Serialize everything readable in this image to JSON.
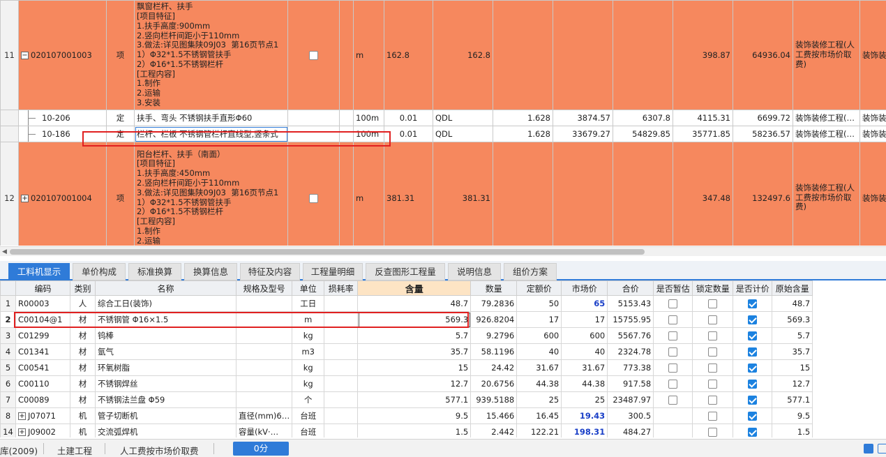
{
  "bills": [
    {
      "num": "11",
      "code": "020107001003",
      "unit_type": "项",
      "desc": "飘窗栏杆、扶手\n[项目特征]\n1.扶手高度:900mm\n2.竖向栏杆间距小于110mm\n3.做法:详见图集陕09J03  第16页节点1\n1）Φ32*1.5不锈钢管扶手\n2）Φ16*1.5不锈钢栏杆\n[工程内容]\n1.制作\n2.运输\n3.安装",
      "unit": "m",
      "qty_expr": "162.8",
      "qty": "162.8",
      "price": "398.87",
      "total": "64936.04",
      "category": "装饰装修工程(人工费按市场价取费)",
      "profession": "装饰装修"
    },
    {
      "num": "12",
      "code": "020107001004",
      "unit_type": "项",
      "desc": "阳台栏杆、扶手（南面）\n[项目特征]\n1.扶手高度:450mm\n2.竖向栏杆间距小于110mm\n3.做法:详见图集陕09J03  第16页节点1\n1）Φ32*1.5不锈钢管扶手\n2）Φ16*1.5不锈钢栏杆\n[工程内容]\n1.制作\n2.运输",
      "unit": "m",
      "qty_expr": "381.31",
      "qty": "381.31",
      "price": "347.48",
      "total": "132497.6",
      "category": "装饰装修工程(人工费按市场价取费)",
      "profession": "装饰装修"
    }
  ],
  "quotas": [
    {
      "code": "10-206",
      "type": "定",
      "name": "扶手、弯头 不锈钢扶手直形Φ60",
      "unit": "100m",
      "ratio": "0.01",
      "expr": "QDL",
      "qty": "1.628",
      "unit_price": "3874.57",
      "base": "6307.8",
      "price2": "4115.31",
      "total": "6699.72",
      "category": "装饰装修工程(…",
      "profession": "装饰装修"
    },
    {
      "code": "10-186",
      "type": "定",
      "name": "栏杆、栏板 不锈钢管栏杆直线型,竖条式",
      "unit": "100m",
      "ratio": "0.01",
      "expr": "QDL",
      "qty": "1.628",
      "unit_price": "33679.27",
      "base": "54829.85",
      "price2": "35771.85",
      "total": "58236.57",
      "category": "装饰装修工程(…",
      "profession": "装饰装修"
    }
  ],
  "tabs": [
    "工料机显示",
    "单价构成",
    "标准换算",
    "换算信息",
    "特征及内容",
    "工程量明细",
    "反查图形工程量",
    "说明信息",
    "组价方案"
  ],
  "res_headers": [
    "",
    "编码",
    "类别",
    "名称",
    "规格及型号",
    "单位",
    "损耗率",
    "含量",
    "数量",
    "定额价",
    "市场价",
    "合价",
    "是否暂估",
    "锁定数量",
    "是否计价",
    "原始含量"
  ],
  "resources": [
    {
      "idx": "1",
      "code": "R00003",
      "type": "人",
      "name": "综合工日(装饰)",
      "spec": "",
      "unit": "工日",
      "content": "48.7",
      "qty": "79.2836",
      "base": "50",
      "market": "65",
      "total": "5153.43",
      "est": false,
      "lock": false,
      "priced": true,
      "orig": "48.7"
    },
    {
      "idx": "2",
      "code": "C00104@1",
      "type": "材",
      "name": "不锈钢管 Φ16×1.5",
      "spec": "",
      "unit": "m",
      "content": "569.3",
      "qty": "926.8204",
      "base": "17",
      "market": "17",
      "total": "15755.95",
      "est": false,
      "lock": false,
      "priced": true,
      "orig": "569.3"
    },
    {
      "idx": "3",
      "code": "C01299",
      "type": "材",
      "name": "钨棒",
      "spec": "",
      "unit": "kg",
      "content": "5.7",
      "qty": "9.2796",
      "base": "600",
      "market": "600",
      "total": "5567.76",
      "est": false,
      "lock": false,
      "priced": true,
      "orig": "5.7"
    },
    {
      "idx": "4",
      "code": "C01341",
      "type": "材",
      "name": "氩气",
      "spec": "",
      "unit": "m3",
      "content": "35.7",
      "qty": "58.1196",
      "base": "40",
      "market": "40",
      "total": "2324.78",
      "est": false,
      "lock": false,
      "priced": true,
      "orig": "35.7"
    },
    {
      "idx": "5",
      "code": "C00541",
      "type": "材",
      "name": "环氧树脂",
      "spec": "",
      "unit": "kg",
      "content": "15",
      "qty": "24.42",
      "base": "31.67",
      "market": "31.67",
      "total": "773.38",
      "est": false,
      "lock": false,
      "priced": true,
      "orig": "15"
    },
    {
      "idx": "6",
      "code": "C00110",
      "type": "材",
      "name": "不锈钢焊丝",
      "spec": "",
      "unit": "kg",
      "content": "12.7",
      "qty": "20.6756",
      "base": "44.38",
      "market": "44.38",
      "total": "917.58",
      "est": false,
      "lock": false,
      "priced": true,
      "orig": "12.7"
    },
    {
      "idx": "7",
      "code": "C00089",
      "type": "材",
      "name": "不锈钢法兰盘 Φ59",
      "spec": "",
      "unit": "个",
      "content": "577.1",
      "qty": "939.5188",
      "base": "25",
      "market": "25",
      "total": "23487.97",
      "est": false,
      "lock": false,
      "priced": true,
      "orig": "577.1"
    },
    {
      "idx": "8",
      "code": "J07071",
      "type": "机",
      "name": "管子切断机",
      "spec": "直径(mm)6…",
      "unit": "台班",
      "content": "9.5",
      "qty": "15.466",
      "base": "16.45",
      "market": "19.43",
      "total": "300.5",
      "est": null,
      "lock": false,
      "priced": true,
      "orig": "9.5",
      "expand": true,
      "blue": true
    },
    {
      "idx": "14",
      "code": "J09002",
      "type": "机",
      "name": "交流弧焊机",
      "spec": "容量(kV·…",
      "unit": "台班",
      "content": "1.5",
      "qty": "2.442",
      "base": "122.21",
      "market": "198.31",
      "total": "484.27",
      "est": null,
      "lock": false,
      "priced": true,
      "orig": "1.5",
      "expand": true,
      "blue": true
    }
  ],
  "status": {
    "item1": "库(2009)",
    "item2": "土建工程",
    "item3": "人工费按市场价取费",
    "pill": "0分"
  }
}
